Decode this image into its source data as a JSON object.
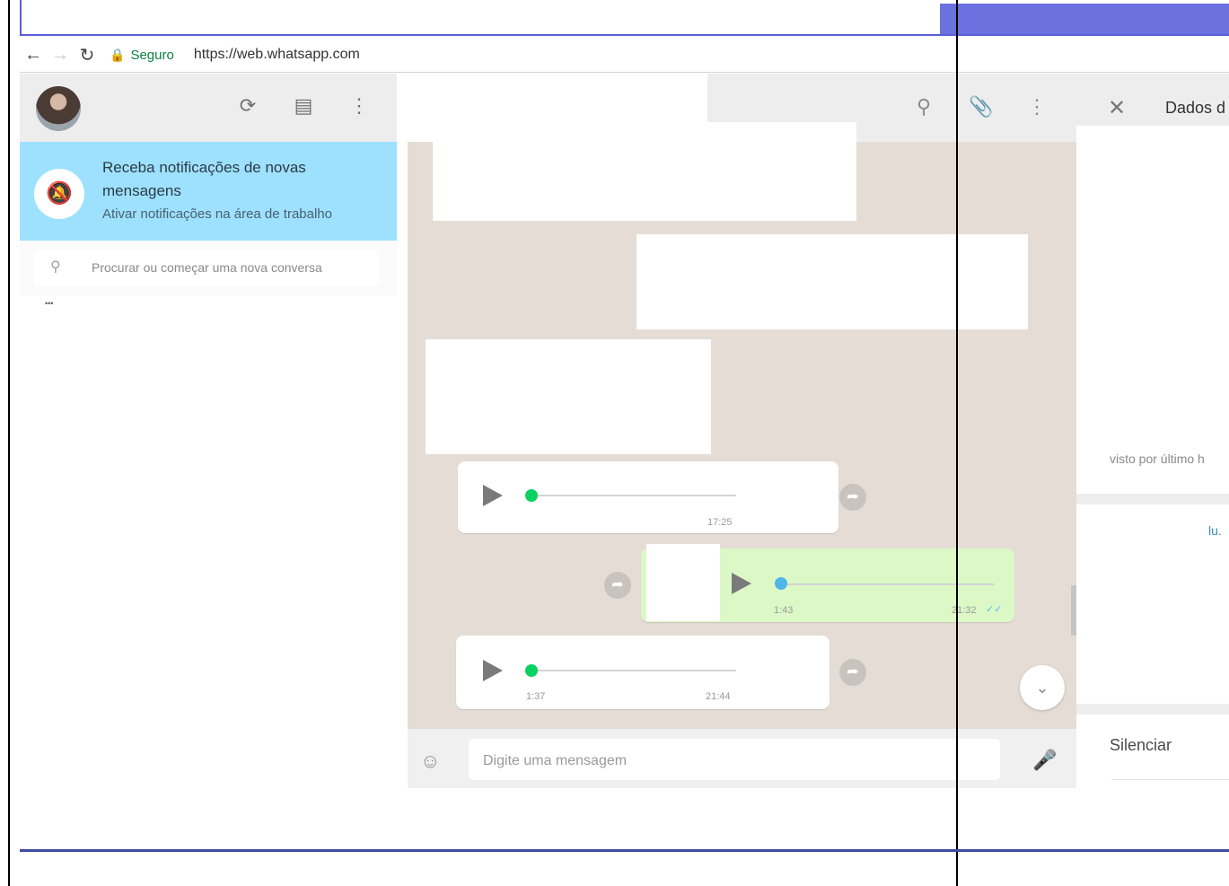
{
  "browser": {
    "back_icon": "arrow-left-icon",
    "forward_icon": "arrow-right-icon",
    "reload_icon": "reload-icon",
    "secure_label": "Seguro",
    "url": "https://web.whatsapp.com"
  },
  "sidebar": {
    "header_icons": [
      "status-icon",
      "new-chat-icon",
      "menu-icon"
    ],
    "notification": {
      "title": "Receba notificações de novas mensagens",
      "subtitle": "Ativar notificações na área de trabalho"
    },
    "search_placeholder": "Procurar ou começar uma nova conversa"
  },
  "chat": {
    "header_icons": [
      "search-icon",
      "attach-icon",
      "menu-icon"
    ],
    "messages": [
      {
        "type": "audio",
        "direction": "in",
        "time": "17:25"
      },
      {
        "type": "audio",
        "direction": "out",
        "duration": "1:43",
        "time": "21:32"
      },
      {
        "type": "audio",
        "direction": "in",
        "duration": "1:37",
        "time": "21:44"
      }
    ],
    "composer_placeholder": "Digite uma mensagem"
  },
  "right_panel": {
    "title": "Dados d",
    "last_seen": "visto por último h",
    "link_fragment": "lu.",
    "mute_label": "Silenciar"
  },
  "colors": {
    "notification_bg": "#9de1fe",
    "chat_bg": "#e5ddd5",
    "outgoing_bubble": "#dcf8c6",
    "audio_dot_in": "#09d261",
    "audio_dot_out": "#4fb6ec",
    "tab_accent": "#6b72e0"
  }
}
